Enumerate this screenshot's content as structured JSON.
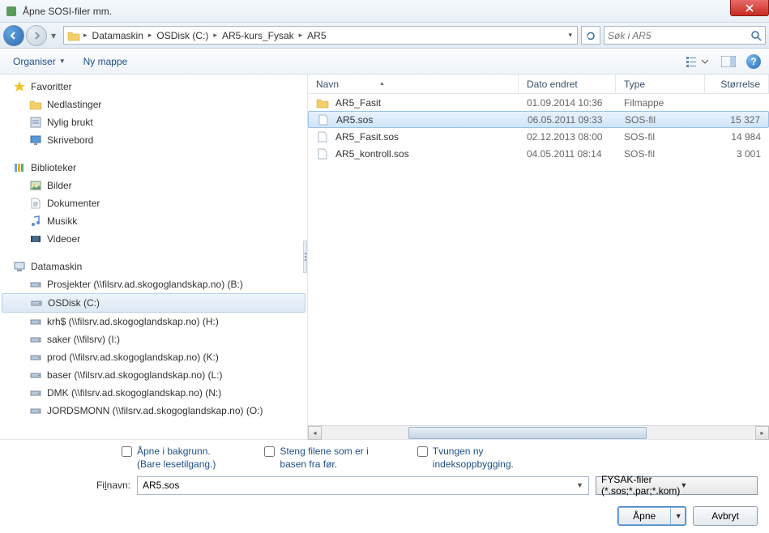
{
  "window": {
    "title": "Åpne SOSI-filer mm."
  },
  "breadcrumb": {
    "segments": [
      "Datamaskin",
      "OSDisk (C:)",
      "AR5-kurs_Fysak",
      "AR5"
    ]
  },
  "search": {
    "placeholder": "Søk i AR5"
  },
  "toolbar": {
    "organize": "Organiser",
    "new_folder": "Ny mappe"
  },
  "sidebar": {
    "favorites": {
      "header": "Favoritter",
      "items": [
        "Nedlastinger",
        "Nylig brukt",
        "Skrivebord"
      ]
    },
    "libraries": {
      "header": "Biblioteker",
      "items": [
        "Bilder",
        "Dokumenter",
        "Musikk",
        "Videoer"
      ]
    },
    "computer": {
      "header": "Datamaskin",
      "items": [
        "Prosjekter (\\\\filsrv.ad.skogoglandskap.no) (B:)",
        "OSDisk (C:)",
        "krh$ (\\\\filsrv.ad.skogoglandskap.no) (H:)",
        "saker (\\\\filsrv) (I:)",
        "prod (\\\\filsrv.ad.skogoglandskap.no) (K:)",
        "baser (\\\\filsrv.ad.skogoglandskap.no) (L:)",
        "DMK (\\\\filsrv.ad.skogoglandskap.no) (N:)",
        "JORDSMONN (\\\\filsrv.ad.skogoglandskap.no) (O:)"
      ],
      "selected_index": 1
    }
  },
  "filelist": {
    "columns": {
      "name": "Navn",
      "date": "Dato endret",
      "type": "Type",
      "size": "Størrelse"
    },
    "rows": [
      {
        "name": "AR5_Fasit",
        "date": "01.09.2014 10:36",
        "type": "Filmappe",
        "size": "",
        "kind": "folder"
      },
      {
        "name": "AR5.sos",
        "date": "06.05.2011 09:33",
        "type": "SOS-fil",
        "size": "15 327",
        "kind": "file",
        "selected": true
      },
      {
        "name": "AR5_Fasit.sos",
        "date": "02.12.2013 08:00",
        "type": "SOS-fil",
        "size": "14 984",
        "kind": "file"
      },
      {
        "name": "AR5_kontroll.sos",
        "date": "04.05.2011 08:14",
        "type": "SOS-fil",
        "size": "3 001",
        "kind": "file"
      }
    ]
  },
  "options": {
    "opt1_line1": "Åpne i bakgrunn.",
    "opt1_line2": "(Bare lesetilgang.)",
    "opt2_line1": "Steng filene som er i",
    "opt2_line2": "basen fra før.",
    "opt3_line1": "Tvungen ny",
    "opt3_line2": "indeksoppbygging."
  },
  "filename": {
    "label_pre": "Fi",
    "label_u": "l",
    "label_post": "navn:",
    "value": "AR5.sos",
    "filter": "FYSAK-filer (*.sos;*.par;*.kom)"
  },
  "buttons": {
    "open": "Åpne",
    "cancel": "Avbryt"
  }
}
